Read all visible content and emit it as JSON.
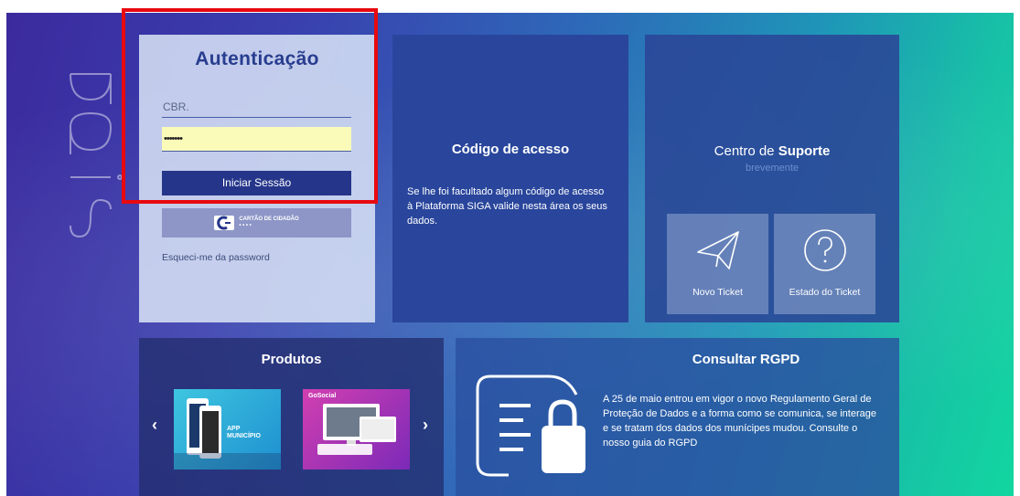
{
  "login": {
    "title": "Autenticação",
    "username_value": "CBR.",
    "password_mask": "•••••••",
    "submit_label": "Iniciar Sessão",
    "cc_label_line1": "CARTÃO DE CIDADÃO",
    "cc_label_line2": "• • • •",
    "forgot_label": "Esqueci-me da password"
  },
  "access": {
    "title": "Código de acesso",
    "description": "Se lhe foi facultado algum código de acesso à Plataforma SIGA valide nesta área os seus dados."
  },
  "support": {
    "title_prefix": "Centro de ",
    "title_bold": "Suporte",
    "soon": "brevemente",
    "new_ticket": "Novo Ticket",
    "ticket_status": "Estado do Ticket"
  },
  "produtos": {
    "title": "Produtos",
    "prev": "‹",
    "next": "›",
    "item1_line1": "APP",
    "item1_line2": "MUNICÍPIO",
    "item2_label": "GoSocial"
  },
  "rgpd": {
    "title": "Consultar RGPD",
    "description": "A 25 de maio entrou em vigor o novo Regulamento Geral de Proteção de Dados e a forma como se comunica, se interage e se tratam dos dados dos munícipes mudou. Consulte o nosso guia do RGPD"
  },
  "brand": "siga",
  "colors": {
    "highlight": "#e8090f",
    "button": "#25368a",
    "password_bg": "#fafbb8"
  }
}
